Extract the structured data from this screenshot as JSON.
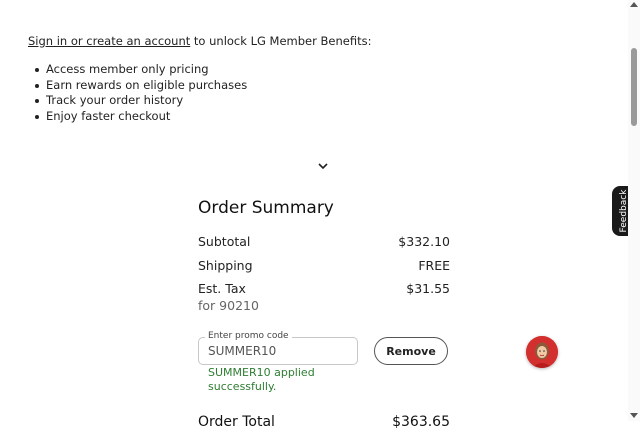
{
  "signin": {
    "link_text": "Sign in or create an account",
    "rest_text": " to unlock LG Member Benefits:"
  },
  "benefits": [
    "Access member only pricing",
    "Earn rewards on eligible purchases",
    "Track your order history",
    "Enjoy faster checkout"
  ],
  "expand_icon": "chevron-down",
  "order_summary": {
    "title": "Order Summary",
    "subtotal_label": "Subtotal",
    "subtotal_value": "$332.10",
    "shipping_label": "Shipping",
    "shipping_value": "FREE",
    "tax_label": "Est. Tax",
    "tax_value": "$31.55",
    "tax_location": "for 90210",
    "promo_label": "Enter promo code",
    "promo_value": "SUMMER10",
    "remove_label": "Remove",
    "promo_message": "SUMMER10 applied successfully.",
    "total_label": "Order Total",
    "total_value": "$363.65"
  },
  "feedback": {
    "label": "Feedback"
  },
  "chat": {
    "icon": "chat-agent-avatar"
  },
  "colors": {
    "success_text": "#2e7d32",
    "feedback_bg": "#1a1a1a",
    "avatar_bg": "#d32f2f"
  }
}
